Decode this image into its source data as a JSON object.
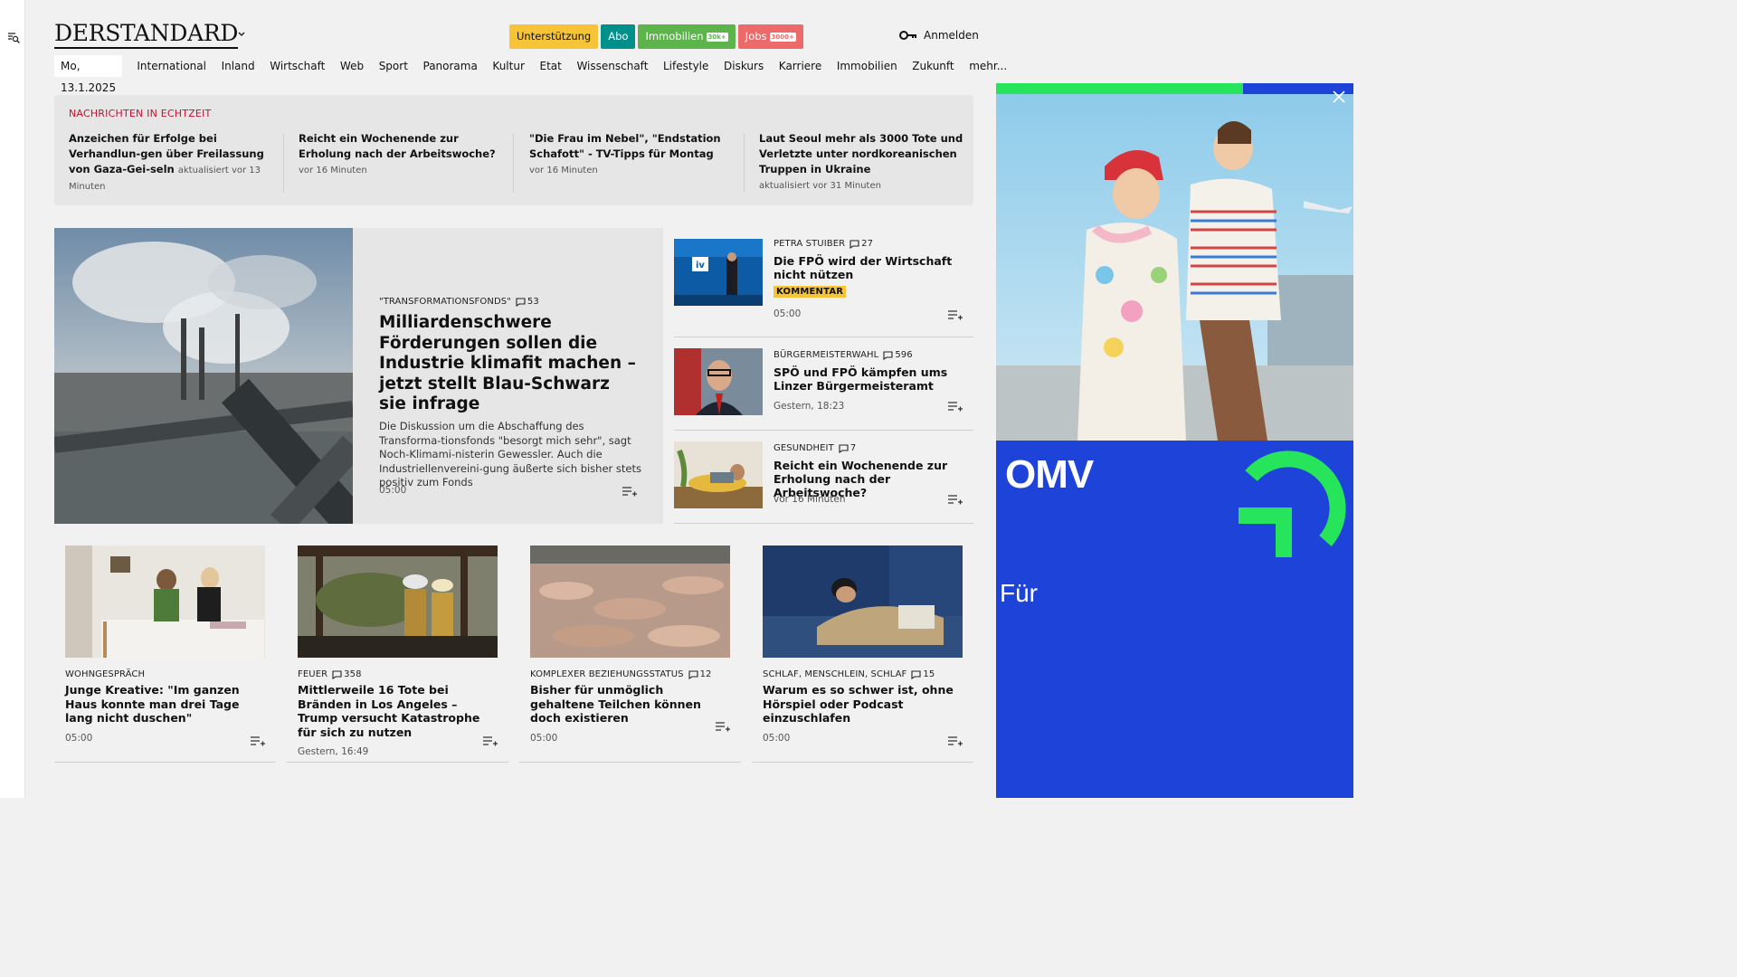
{
  "header": {
    "logo": "DERSTANDARD",
    "pills": [
      {
        "label": "Unterstützung",
        "badge": ""
      },
      {
        "label": "Abo",
        "badge": ""
      },
      {
        "label": "Immobilien",
        "badge": "30k+"
      },
      {
        "label": "Jobs",
        "badge": "3000+"
      }
    ],
    "login": "Anmelden"
  },
  "nav": {
    "date": "Mo, 13.1.2025",
    "items": [
      "International",
      "Inland",
      "Wirtschaft",
      "Web",
      "Sport",
      "Panorama",
      "Kultur",
      "Etat",
      "Wissenschaft",
      "Lifestyle",
      "Diskurs",
      "Karriere",
      "Immobilien",
      "Zukunft",
      "mehr..."
    ]
  },
  "ticker": {
    "heading": "NACHRICHTEN IN ECHTZEIT",
    "items": [
      {
        "title": "Anzeichen für Erfolge bei Verhandlun-gen über Freilassung von Gaza-Gei-seln",
        "time": "aktualisiert vor 13 Minuten"
      },
      {
        "title": "Reicht ein Wochenende zur Erholung nach der Arbeitswoche?",
        "time": "vor 16 Minuten"
      },
      {
        "title": "\"Die Frau im Nebel\", \"Endstation Schafott\" - TV-Tipps für Montag",
        "time": "vor 16 Minuten"
      },
      {
        "title": "Laut Seoul mehr als 3000 Tote und Verletzte unter nordkoreanischen Truppen in Ukraine",
        "time": "aktualisiert vor 31 Minuten"
      }
    ]
  },
  "lead": {
    "kicker": "\"TRANSFORMATIONSFONDS\"",
    "comments": "53",
    "title": "Milliardenschwere Förderungen sollen die Industrie klimafit machen – jetzt stellt Blau-Schwarz sie infrage",
    "teaser": "Die Diskussion um die Abschaffung des Transforma-tionsfonds \"besorgt mich sehr\", sagt Noch-Klimami-nisterin Gewessler. Auch die Industriellenvereini-gung äußerte sich bisher stets positiv zum Fonds",
    "time": "05:00"
  },
  "side": [
    {
      "kicker": "PETRA STUIBER",
      "comments": "27",
      "title": "Die FPÖ wird der Wirtschaft nicht nützen",
      "tag": "KOMMENTAR",
      "time": "05:00"
    },
    {
      "kicker": "BÜRGERMEISTERWAHL",
      "comments": "596",
      "title": "SPÖ und FPÖ kämpfen ums Linzer Bürgermeisteramt",
      "tag": "",
      "time": "Gestern, 18:23"
    },
    {
      "kicker": "GESUNDHEIT",
      "comments": "7",
      "title": "Reicht ein Wochenende zur Erholung nach der Arbeitswoche?",
      "tag": "",
      "time": "vor 16 Minuten"
    }
  ],
  "cards": [
    {
      "kicker": "WOHNGESPRÄCH",
      "comments": "",
      "title": "Junge Kreative: \"Im ganzen Haus konnte man drei Tage lang nicht duschen\"",
      "time": "05:00"
    },
    {
      "kicker": "FEUER",
      "comments": "358",
      "title": "Mittlerweile 16 Tote bei Bränden in Los Angeles – Trump versucht Katastrophe für sich zu nutzen",
      "time": "Gestern, 16:49"
    },
    {
      "kicker": "KOMPLEXER BEZIEHUNGSSTATUS",
      "comments": "12",
      "title": "Bisher für unmöglich gehaltene Teilchen können doch existieren",
      "time": "05:00"
    },
    {
      "kicker": "SCHLAF, MENSCHLEIN, SCHLAF",
      "comments": "15",
      "title": "Warum es so schwer ist, ohne Hörspiel oder Podcast einzuschlafen",
      "time": "05:00"
    }
  ],
  "ad": {
    "brand": "OMV",
    "tagline": "Für",
    "progress": 0.69
  }
}
